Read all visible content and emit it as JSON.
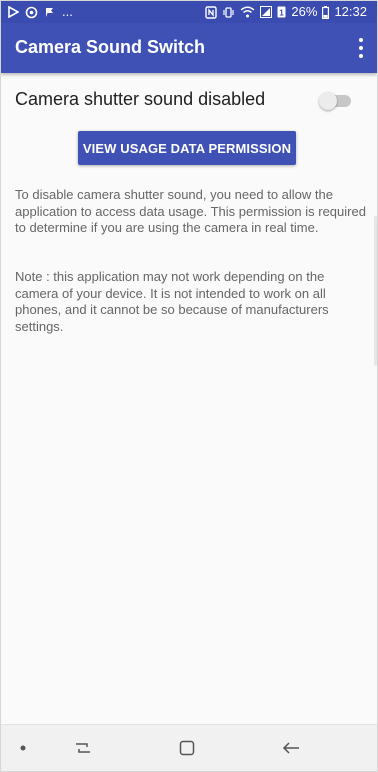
{
  "status_bar": {
    "left_icons": [
      "play-store-notification-icon",
      "sync-notification-icon",
      "flag-notification-icon"
    ],
    "more_notifications": "...",
    "right_icons": [
      "nfc-icon",
      "vibrate-icon",
      "wifi-icon",
      "signal-icon",
      "sim-1-icon"
    ],
    "battery_percent": "26%",
    "time": "12:32"
  },
  "app_bar": {
    "title": "Camera Sound Switch",
    "overflow_icon": "more-vert-icon"
  },
  "setting": {
    "label": "Camera shutter sound disabled",
    "toggle_on": false
  },
  "permission_button": {
    "label": "VIEW USAGE DATA PERMISSION"
  },
  "description": {
    "paragraph_1": "To disable camera shutter sound, you need to allow the application to access data usage. This permission is required to determine if you are using the camera in real time.",
    "paragraph_2": "Note : this application may not work depending on the camera of your device. It is not intended to work on all phones, and it cannot be so because of manufacturers settings."
  },
  "nav_bar": {
    "items": [
      "dot-icon",
      "recent-apps-icon",
      "home-icon",
      "back-icon"
    ]
  },
  "colors": {
    "primary": "#3f51b5",
    "primary_dark": "#3b4cb0",
    "text_primary": "#212121",
    "text_secondary": "#666666",
    "background": "#fafafa"
  }
}
